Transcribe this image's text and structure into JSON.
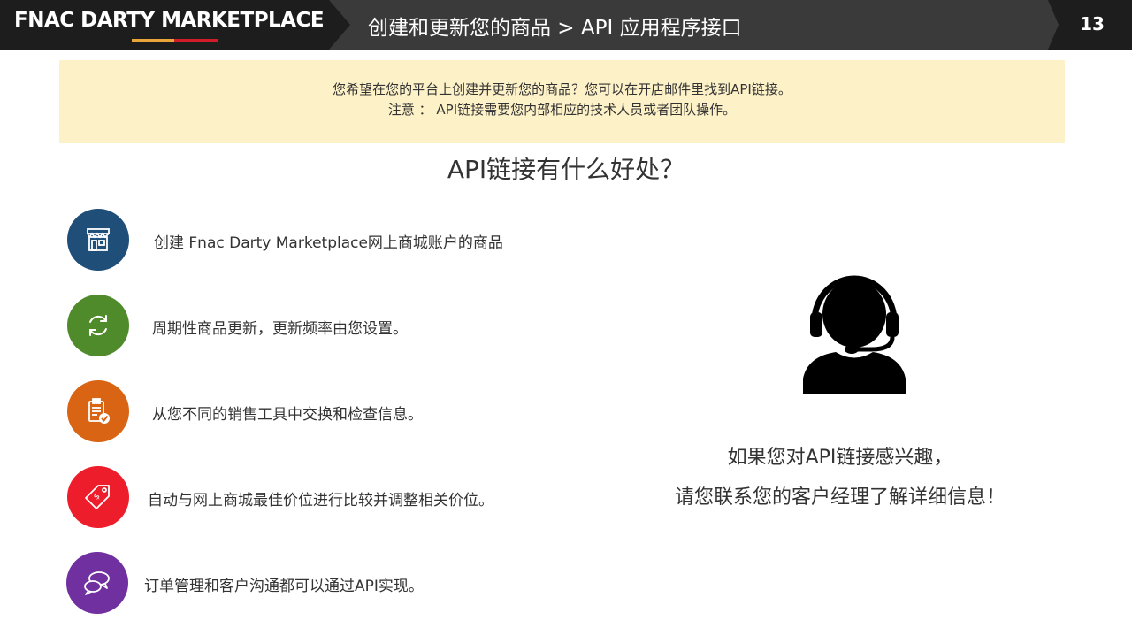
{
  "header": {
    "logo_text": "FNAC DARTY MARKETPLACE",
    "title": "创建和更新您的商品 > API 应用程序接口",
    "page_number": "13"
  },
  "notice": {
    "line1": "您希望在您的平台上创建并更新您的商品？您可以在开店邮件里找到API链接。",
    "line2": "注意 ： API链接需要您内部相应的技术人员或者团队操作。"
  },
  "benefits_title": "API链接有什么好处？",
  "benefits": [
    {
      "icon": "storefront-icon",
      "color": "#1f4e79",
      "text": "创建 Fnac Darty Marketplace网上商城账户的商品"
    },
    {
      "icon": "refresh-icon",
      "color": "#4f8a2b",
      "text": "周期性商品更新，更新频率由您设置。"
    },
    {
      "icon": "clipboard-check-icon",
      "color": "#d86414",
      "text": "从您不同的销售工具中交换和检查信息。"
    },
    {
      "icon": "price-tag-icon",
      "color": "#ee1d2b",
      "text": "自动与网上商城最佳价位进行比较并调整相关价位。"
    },
    {
      "icon": "chat-bubbles-icon",
      "color": "#7030a0",
      "text": "订单管理和客户沟通都可以通过API实现。"
    }
  ],
  "contact": {
    "icon": "customer-support-icon",
    "line1": "如果您对API链接感兴趣，",
    "line2": "请您联系您的客户经理了解详细信息！"
  }
}
